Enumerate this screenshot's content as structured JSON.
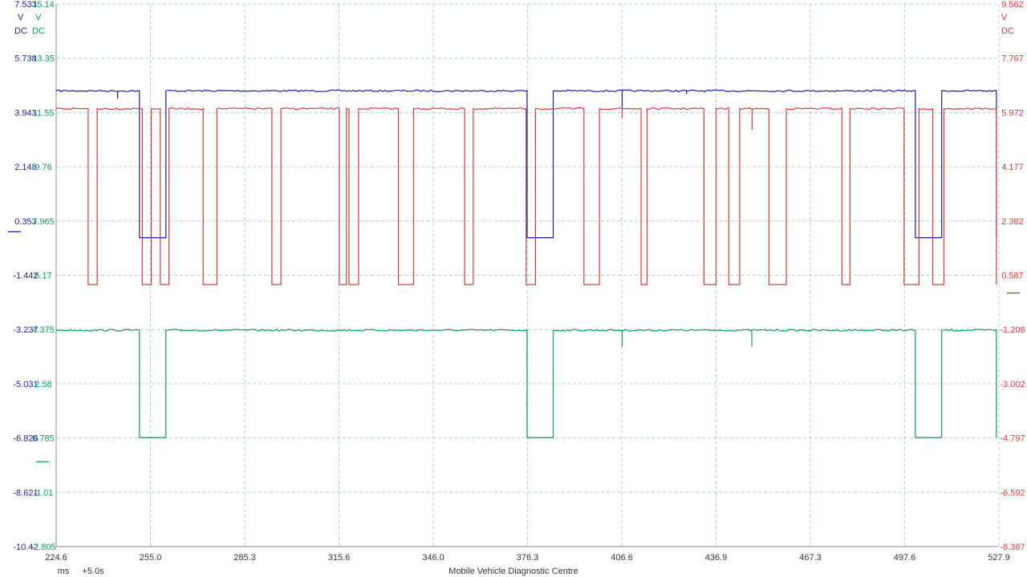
{
  "chart_data": {
    "type": "line",
    "title": "",
    "footer_label": "Mobile Vehicle Diagnostic Centre",
    "grid": true,
    "x_axis": {
      "unit": "ms",
      "offset_label": "+5.0s",
      "range": [
        224.6,
        527.9
      ],
      "tick_labels": [
        "224.6",
        "255.0",
        "285.3",
        "315.6",
        "346.0",
        "376.3",
        "406.6",
        "436.9",
        "467.3",
        "497.6",
        "527.9"
      ]
    },
    "y_axes": [
      {
        "id": "blue",
        "side": "left",
        "color": "#1a1aa6",
        "unit_line1": "V",
        "unit_line2": "DC",
        "range": [
          -10.42,
          7.533
        ],
        "tick_labels": [
          "7.533",
          "5.738",
          "3.943",
          "2.148",
          "0.353",
          "-1.442",
          "-3.237",
          "-5.031",
          "-6.826",
          "-8.621",
          "-10.42"
        ]
      },
      {
        "id": "green",
        "side": "left",
        "color": "#0e9a5a",
        "unit_line1": "V",
        "unit_line2": "DC",
        "range": [
          -2.805,
          15.14
        ],
        "tick_labels": [
          "15.14",
          "13.35",
          "11.55",
          "9.76",
          "7.965",
          "6.17",
          "4.375",
          "2.58",
          "0.785",
          "-1.01",
          "-2.805"
        ]
      },
      {
        "id": "red",
        "side": "right",
        "color": "#d83a3a",
        "unit_line1": "V",
        "unit_line2": "DC",
        "range": [
          -8.387,
          9.562
        ],
        "tick_labels": [
          "9.562",
          "7.767",
          "5.972",
          "4.177",
          "2.382",
          "0.587",
          "-1.208",
          "-3.002",
          "-4.797",
          "-6.592",
          "-8.387"
        ]
      }
    ],
    "series": [
      {
        "axis": "blue",
        "color": "#1a1aa6",
        "zero_marker": 0,
        "high": 4.66,
        "low": -0.2,
        "segments": [
          [
            224.6,
            251.4
          ],
          [
            259.9,
            376.1
          ],
          [
            384.5,
            501.0
          ],
          [
            509.5,
            527.1
          ]
        ],
        "spikes": [
          [
            244.4,
            4.4
          ],
          [
            406.7,
            4.1
          ],
          [
            427.4,
            4.55
          ]
        ]
      },
      {
        "axis": "green",
        "color": "#0e9a5a",
        "zero_marker": 0,
        "high": 4.35,
        "low": 0.8,
        "segments": [
          [
            224.6,
            251.4
          ],
          [
            259.9,
            376.1
          ],
          [
            384.5,
            501.0
          ],
          [
            509.5,
            527.1
          ]
        ],
        "spikes": [
          [
            406.7,
            3.8
          ],
          [
            448.4,
            3.8
          ]
        ]
      },
      {
        "axis": "red",
        "color": "#d83a3a",
        "zero_marker": 0,
        "high": 6.1,
        "low": 0.28,
        "segments": [
          [
            224.6,
            234.9
          ],
          [
            237.8,
            252.3
          ],
          [
            255.2,
            258.1
          ],
          [
            260.9,
            271.9
          ],
          [
            276.3,
            294.0
          ],
          [
            296.9,
            315.7
          ],
          [
            318.0,
            318.8
          ],
          [
            321.9,
            334.7
          ],
          [
            339.6,
            356.0
          ],
          [
            358.8,
            375.8
          ],
          [
            378.8,
            394.4
          ],
          [
            399.4,
            412.8
          ],
          [
            414.7,
            433.0
          ],
          [
            436.9,
            441.0
          ],
          [
            444.5,
            453.9
          ],
          [
            459.5,
            477.4
          ],
          [
            480.0,
            497.4
          ],
          [
            502.2,
            506.6
          ],
          [
            510.2,
            527.1
          ]
        ],
        "spikes": [
          [
            406.7,
            5.8
          ],
          [
            448.5,
            5.4
          ]
        ]
      }
    ]
  }
}
